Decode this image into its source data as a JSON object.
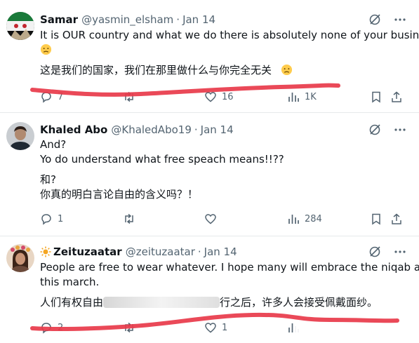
{
  "tweets": [
    {
      "name": "Samar",
      "handle": "@yasmin_elsham",
      "time": "Jan 14",
      "lines": [
        "It is OUR country and what we do there is absolutely none of your business",
        "这是我们的国家，我们在那里做什么与你完全无关"
      ],
      "stats": {
        "reply": "7",
        "retweet": "",
        "like": "16",
        "views": "1K"
      }
    },
    {
      "name": "Khaled Abo",
      "handle": "@KhaledAbo19",
      "time": "Jan 14",
      "lines": [
        "And?",
        "Yo do understand what free speach means!!??",
        "和?",
        "你真的明白言论自由的含义吗？！"
      ],
      "stats": {
        "reply": "1",
        "retweet": "",
        "like": "",
        "views": "284"
      }
    },
    {
      "name": "Zeituzaatar",
      "handle": "@zeituzaatar",
      "time": "Jan 14",
      "lines": [
        "People are free to wear whatever. I hope many will embrace the niqab after",
        "this march.",
        "人们有权自由",
        "行之后，许多人会接受佩戴面纱。"
      ],
      "stats": {
        "reply": "2",
        "retweet": "",
        "like": "1",
        "views": ""
      }
    }
  ],
  "separator": "·",
  "icons": [
    "grok-icon",
    "more-icon",
    "reply-icon",
    "retweet-icon",
    "like-icon",
    "views-icon",
    "bookmark-icon",
    "share-icon",
    "sun-icon",
    "frown-emoji-icon"
  ],
  "colors": {
    "text": "#0f1419",
    "muted": "#536471",
    "annotation": "#e8394a",
    "divider": "#e6e9eb"
  }
}
